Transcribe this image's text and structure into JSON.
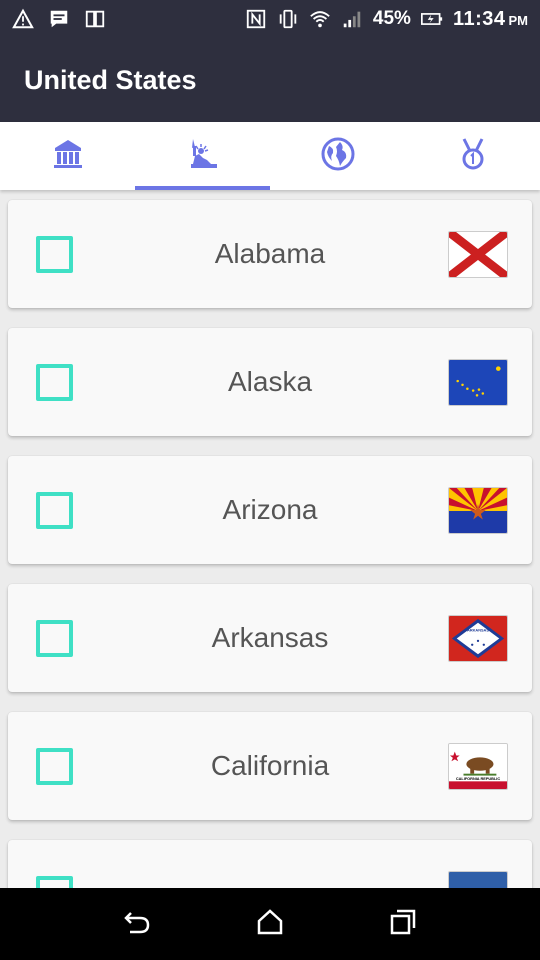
{
  "status_bar": {
    "battery": "45%",
    "time": "11:34",
    "ampm": "PM",
    "icons": [
      "alert-icon",
      "message-icon",
      "device-icon",
      "nfc-icon",
      "vibrate-icon",
      "wifi-icon",
      "signal-icon",
      "battery-icon"
    ]
  },
  "app_bar": {
    "title": "United States"
  },
  "tabs": [
    {
      "icon": "capitol-building-icon",
      "active": false
    },
    {
      "icon": "statue-of-liberty-icon",
      "active": true
    },
    {
      "icon": "globe-icon",
      "active": false
    },
    {
      "icon": "medal-icon",
      "active": false
    }
  ],
  "colors": {
    "bar": "#2e2f3e",
    "accent": "#6c75e5",
    "checkbox": "#3fe0c5"
  },
  "states": [
    {
      "name": "Alabama",
      "checked": false,
      "flag": "alabama-flag"
    },
    {
      "name": "Alaska",
      "checked": false,
      "flag": "alaska-flag"
    },
    {
      "name": "Arizona",
      "checked": false,
      "flag": "arizona-flag"
    },
    {
      "name": "Arkansas",
      "checked": false,
      "flag": "arkansas-flag",
      "flag_text": "ARKANSAS"
    },
    {
      "name": "California",
      "checked": false,
      "flag": "california-flag",
      "flag_text": "CALIFORNIA REPUBLIC"
    }
  ],
  "nav_bar": {
    "icons": [
      "back-icon",
      "home-icon",
      "recents-icon"
    ]
  }
}
